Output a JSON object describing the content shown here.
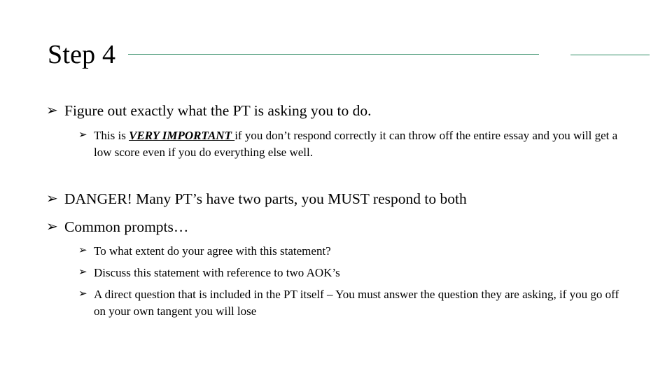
{
  "slide": {
    "title": "Step 4",
    "bullet_glyph": "➜",
    "bullet_glyph_name": "arrowhead-bullet",
    "accent_color": "#2e8b63",
    "background_color": "#ffffff",
    "text_color": "#000000"
  },
  "content": {
    "bullet1": {
      "marker": "➢",
      "text": "Figure out exactly what the PT is asking you to do."
    },
    "sub1": {
      "marker": "➢",
      "prefix": "This is ",
      "emphasis": "VERY IMPORTANT ",
      "suffix": "if you don’t respond correctly it can throw off the entire essay and you will get a low score even if you do everything else well."
    },
    "bullet2": {
      "marker": "➢",
      "text": "DANGER! Many PT’s have two parts, you MUST respond to both"
    },
    "bullet3": {
      "marker": "➢",
      "text": "Common prompts…"
    },
    "sub2": {
      "marker": "➢",
      "text": "To what extent do your agree with this statement?"
    },
    "sub3": {
      "marker": "➢",
      "text": "Discuss this statement with reference to two AOK’s"
    },
    "sub4": {
      "marker": "➢",
      "text": "A direct question that is included in the PT itself – You must answer the question they are asking, if you go off on your own tangent you will lose"
    }
  }
}
